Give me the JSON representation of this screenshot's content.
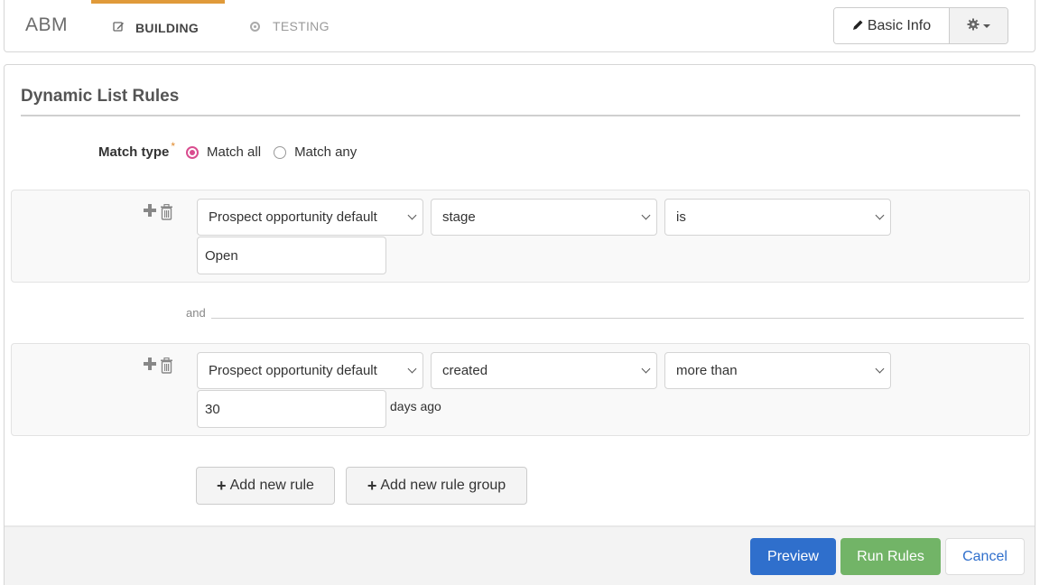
{
  "nav": {
    "brand": "ABM",
    "tabs": [
      {
        "label": "BUILDING",
        "icon": "edit-icon",
        "active": true
      },
      {
        "label": "TESTING",
        "icon": "target-icon",
        "active": false
      }
    ],
    "accent_color": "#e09a3a",
    "basic_info_label": "Basic Info",
    "settings_icon": "gear-icon"
  },
  "panel": {
    "title": "Dynamic List Rules",
    "match_type": {
      "label": "Match type",
      "required_mark": "*",
      "options": [
        {
          "label": "Match all",
          "checked": true
        },
        {
          "label": "Match any",
          "checked": false
        }
      ]
    },
    "rules": [
      {
        "object": "Prospect opportunity default",
        "field": "stage",
        "operator": "is",
        "value": "Open",
        "suffix": ""
      },
      {
        "object": "Prospect opportunity default",
        "field": "created",
        "operator": "more than",
        "value": "30",
        "suffix": "days ago"
      }
    ],
    "connector": "and",
    "add_rule_label": "Add new rule",
    "add_group_label": "Add new rule group"
  },
  "footer": {
    "preview_label": "Preview",
    "run_label": "Run Rules",
    "cancel_label": "Cancel",
    "colors": {
      "preview": "#2f6fcc",
      "run": "#72b467",
      "cancel_text": "#2f6fcc"
    }
  }
}
